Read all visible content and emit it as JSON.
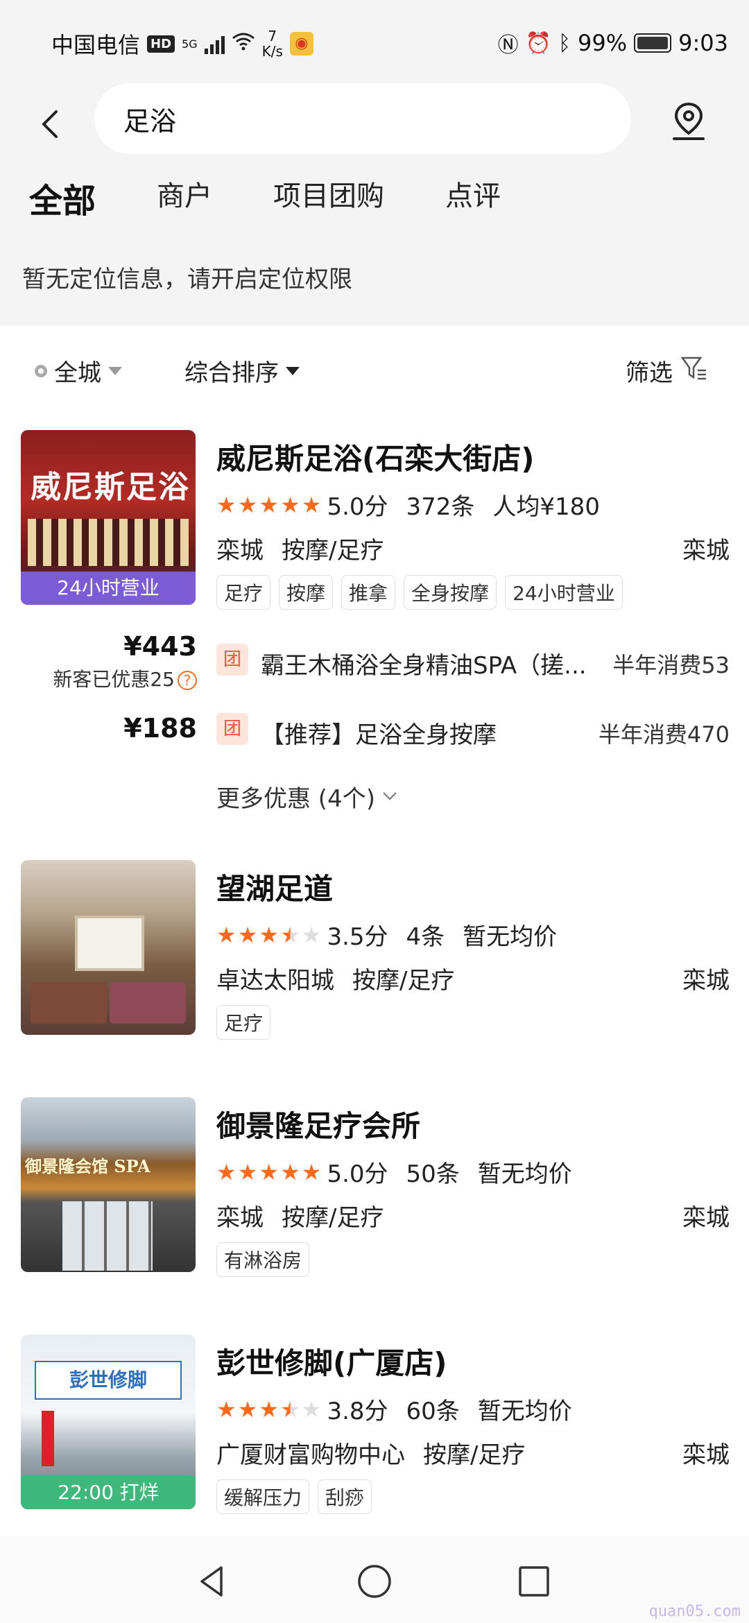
{
  "status_bar": {
    "carrier": "中国电信",
    "hd": "HD",
    "net_type": "5G",
    "speed_value": "7",
    "speed_unit": "K/s",
    "battery": "99%",
    "time": "9:03"
  },
  "search": {
    "query": "足浴"
  },
  "tabs": [
    {
      "label": "全部",
      "active": true
    },
    {
      "label": "商户"
    },
    {
      "label": "项目团购"
    },
    {
      "label": "点评"
    }
  ],
  "notice": "暂无定位信息，请开启定位权限",
  "filters": {
    "area": "全城",
    "sort": "综合排序",
    "filter": "筛选"
  },
  "listings": [
    {
      "name": "威尼斯足浴(石栾大街店)",
      "stars": 5,
      "score": "5.0分",
      "reviews": "372条",
      "price": "人均¥180",
      "district": "栾城",
      "category": "按摩/足疗",
      "region": "栾城",
      "badge": "24小时营业",
      "thumb_text": "威尼斯足浴",
      "tags": [
        "足疗",
        "按摩",
        "推拿",
        "全身按摩",
        "24小时营业"
      ],
      "deals": [
        {
          "price": "¥443",
          "sub": "新客已优惠25",
          "tuan": "团",
          "title": "霸王木桶浴全身精油SPA（搓...",
          "sales": "半年消费53"
        },
        {
          "price": "¥188",
          "tuan": "团",
          "title": "【推荐】足浴全身按摩",
          "sales": "半年消费470"
        }
      ],
      "more": "更多优惠 (4个)"
    },
    {
      "name": "望湖足道",
      "stars": 3.5,
      "score": "3.5分",
      "reviews": "4条",
      "price": "暂无均价",
      "district": "卓达太阳城",
      "category": "按摩/足疗",
      "region": "栾城",
      "tags": [
        "足疗"
      ]
    },
    {
      "name": "御景隆足疗会所",
      "stars": 5,
      "score": "5.0分",
      "reviews": "50条",
      "price": "暂无均价",
      "district": "栾城",
      "category": "按摩/足疗",
      "region": "栾城",
      "thumb_text": "御景隆会馆 SPA",
      "tags": [
        "有淋浴房"
      ]
    },
    {
      "name": "彭世修脚(广厦店)",
      "stars": 3.5,
      "score": "3.8分",
      "reviews": "60条",
      "price": "暂无均价",
      "district": "广厦财富购物中心",
      "category": "按摩/足疗",
      "region": "栾城",
      "badge": "22:00 打烊",
      "thumb_text": "彭世修脚",
      "tags": [
        "缓解压力",
        "刮痧"
      ]
    }
  ],
  "watermark": "quan05.com",
  "colors": {
    "star": "#ff6a1a",
    "tab_underline": "#ffd21f",
    "badge_purple": "#7b5cd6",
    "badge_green": "#3fb87c"
  }
}
